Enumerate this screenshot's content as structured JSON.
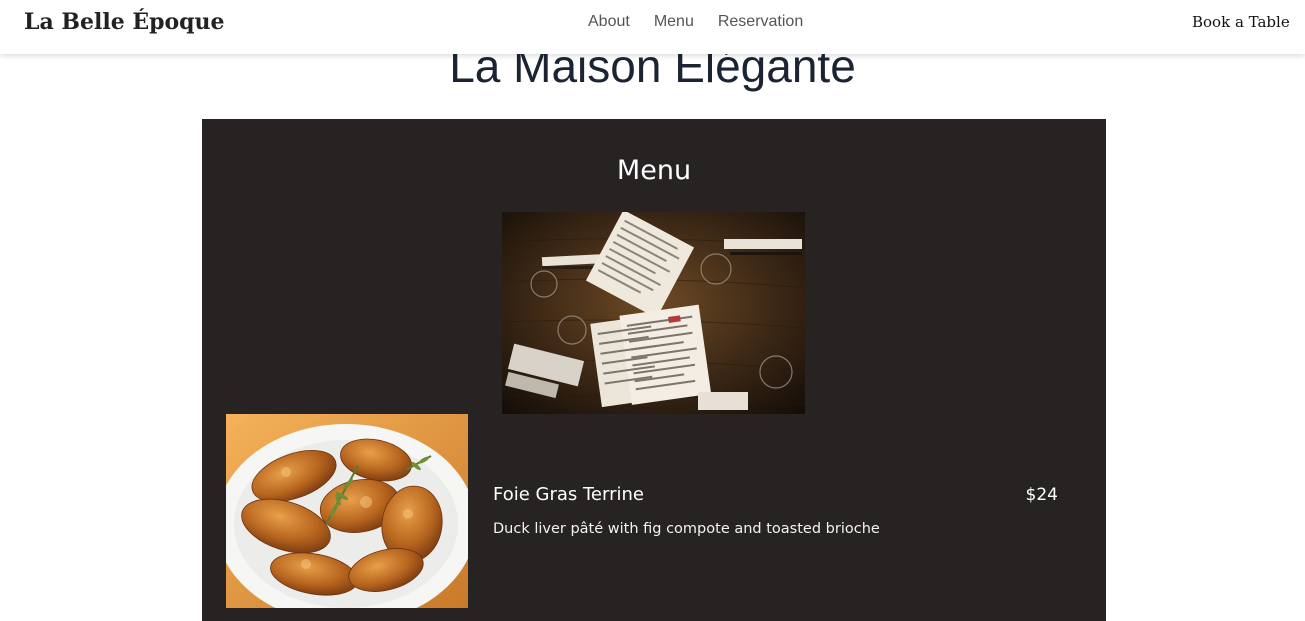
{
  "header": {
    "brand": "La Belle Époque",
    "nav": [
      {
        "label": "About"
      },
      {
        "label": "Menu"
      },
      {
        "label": "Reservation"
      }
    ],
    "book_label": "Book a Table"
  },
  "hero": {
    "title": "La Maison Élégante"
  },
  "menu": {
    "heading": "Menu",
    "items": [
      {
        "name": "Foie Gras Terrine",
        "price": "$24",
        "description": "Duck liver pâté with fig compote and toasted brioche"
      }
    ]
  },
  "colors": {
    "menu_background": "#272323",
    "title_text": "#1c2433",
    "nav_text": "#555555"
  }
}
